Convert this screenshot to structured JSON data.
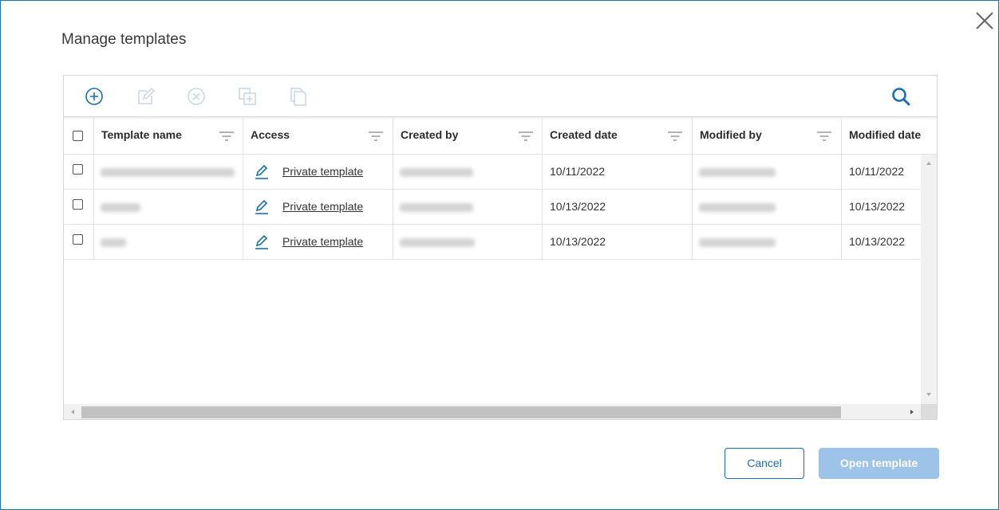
{
  "dialog": {
    "title": "Manage templates"
  },
  "toolbar": {
    "buttons": [
      {
        "icon": "add-circle-icon",
        "enabled": true
      },
      {
        "icon": "edit-icon",
        "enabled": false
      },
      {
        "icon": "delete-circle-icon",
        "enabled": false
      },
      {
        "icon": "duplicate-icon",
        "enabled": false
      },
      {
        "icon": "copy-icon",
        "enabled": false
      }
    ],
    "search_icon": "search-icon"
  },
  "table": {
    "columns": [
      "Template name",
      "Access",
      "Created by",
      "Created date",
      "Modified by",
      "Modified date"
    ],
    "rows": [
      {
        "access": "Private template",
        "created_date": "10/11/2022",
        "modified_date": "10/11/2022"
      },
      {
        "access": "Private template",
        "created_date": "10/13/2022",
        "modified_date": "10/13/2022"
      },
      {
        "access": "Private template",
        "created_date": "10/13/2022",
        "modified_date": "10/13/2022"
      }
    ]
  },
  "footer": {
    "cancel_label": "Cancel",
    "open_label": "Open template"
  },
  "colors": {
    "accent": "#1a6fb0",
    "disabled_icon": "#c5d5e6",
    "primary_disabled": "#9dc3e8",
    "border": "#d6d6d6"
  }
}
